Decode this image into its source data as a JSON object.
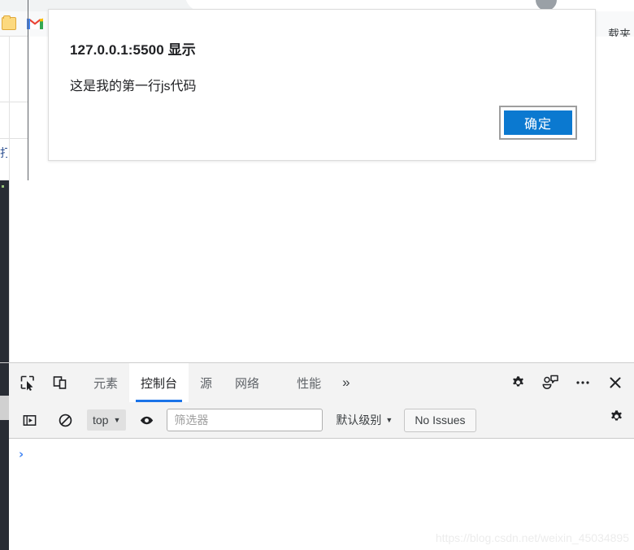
{
  "browser": {
    "bookmarks_label": "载夹",
    "gmail_icon": "gmail-icon",
    "folder_icon": "bookmark-folder-icon",
    "avatar": "profile-avatar"
  },
  "dialog": {
    "title": "127.0.0.1:5500 显示",
    "message": "这是我的第一行js代码",
    "ok_label": "确定"
  },
  "devtools": {
    "inspect_icon": "inspect-element-icon",
    "device_icon": "device-toolbar-icon",
    "tabs": [
      {
        "label": "元素",
        "active": false
      },
      {
        "label": "控制台",
        "active": true
      },
      {
        "label": "源",
        "active": false
      },
      {
        "label": "网络",
        "active": false
      },
      {
        "label": "性能",
        "active": false
      }
    ],
    "more_tabs_label": "»",
    "right_icons": [
      "settings-gear-icon",
      "feedback-icon",
      "more-options-icon",
      "close-devtools-icon"
    ],
    "filterbar": {
      "sidebar_toggle_icon": "console-sidebar-icon",
      "clear_icon": "clear-console-icon",
      "context_value": "top",
      "eye_icon": "live-expression-icon",
      "filter_placeholder": "筛选器",
      "filter_value": "",
      "level_label": "默认级别",
      "issues_label": "No Issues",
      "settings_icon": "console-settings-icon"
    },
    "console": {
      "prompt_symbol": "›",
      "input_value": ""
    }
  },
  "watermark": "https://blog.csdn.net/weixin_45034895",
  "colors": {
    "accent_blue": "#1a73e8",
    "button_blue": "#0b79d0",
    "editor_dark": "#282c34",
    "toolbar_bg": "#f3f3f3"
  }
}
